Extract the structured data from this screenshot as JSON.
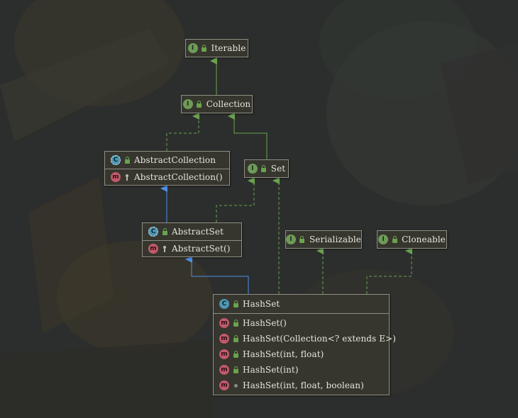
{
  "diagram": {
    "nodes": [
      {
        "id": "iterable",
        "kind": "interface",
        "badge": "I",
        "visibility": "public",
        "name": "Iterable",
        "members": []
      },
      {
        "id": "collection",
        "kind": "interface",
        "badge": "I",
        "visibility": "public",
        "name": "Collection",
        "members": []
      },
      {
        "id": "abstract-collection",
        "kind": "abstract-class",
        "badge": "C",
        "visibility": "public",
        "name": "AbstractCollection",
        "members": [
          {
            "badge": "m",
            "visibility": "protected",
            "signature": "AbstractCollection()"
          }
        ]
      },
      {
        "id": "set",
        "kind": "interface",
        "badge": "I",
        "visibility": "public",
        "name": "Set",
        "members": []
      },
      {
        "id": "abstract-set",
        "kind": "abstract-class",
        "badge": "C",
        "visibility": "public",
        "name": "AbstractSet",
        "members": [
          {
            "badge": "m",
            "visibility": "protected",
            "signature": "AbstractSet()"
          }
        ]
      },
      {
        "id": "serializable",
        "kind": "interface",
        "badge": "I",
        "visibility": "public",
        "name": "Serializable",
        "members": []
      },
      {
        "id": "cloneable",
        "kind": "interface",
        "badge": "I",
        "visibility": "public",
        "name": "Cloneable",
        "members": []
      },
      {
        "id": "hashset",
        "kind": "class",
        "badge": "C",
        "visibility": "public",
        "name": "HashSet",
        "members": [
          {
            "badge": "m",
            "visibility": "public",
            "signature": "HashSet()"
          },
          {
            "badge": "m",
            "visibility": "public",
            "signature": "HashSet(Collection<? extends E>)"
          },
          {
            "badge": "m",
            "visibility": "public",
            "signature": "HashSet(int, float)"
          },
          {
            "badge": "m",
            "visibility": "public",
            "signature": "HashSet(int)"
          },
          {
            "badge": "m",
            "visibility": "package",
            "signature": "HashSet(int, float, boolean)"
          }
        ]
      }
    ],
    "edges": [
      {
        "from": "collection",
        "to": "iterable",
        "type": "extends"
      },
      {
        "from": "abstract-collection",
        "to": "collection",
        "type": "implements"
      },
      {
        "from": "set",
        "to": "collection",
        "type": "extends"
      },
      {
        "from": "abstract-set",
        "to": "abstract-collection",
        "type": "extends-class"
      },
      {
        "from": "abstract-set",
        "to": "set",
        "type": "implements"
      },
      {
        "from": "hashset",
        "to": "abstract-set",
        "type": "extends-class"
      },
      {
        "from": "hashset",
        "to": "set",
        "type": "implements"
      },
      {
        "from": "hashset",
        "to": "serializable",
        "type": "implements"
      },
      {
        "from": "hashset",
        "to": "cloneable",
        "type": "implements"
      }
    ],
    "colors": {
      "interface_edge": "#6aa24e",
      "class_edge": "#4d8ee6",
      "interface_badge": "#6e9b58",
      "class_badge": "#4f97b5",
      "method_badge": "#c15a6b"
    }
  }
}
